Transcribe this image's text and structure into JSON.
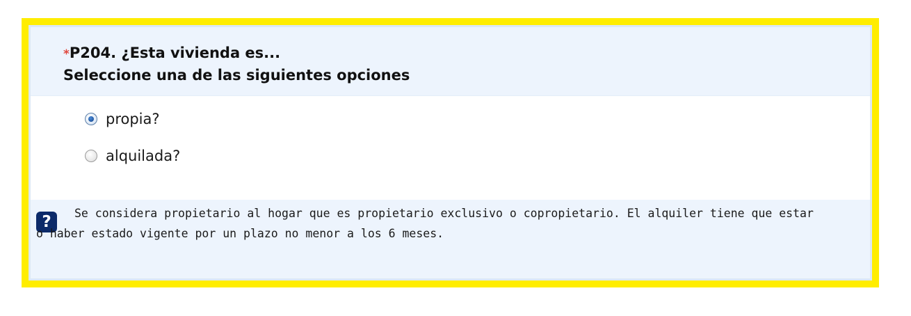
{
  "question": {
    "required_marker": "*",
    "title": "P204. ¿Esta vivienda es...",
    "instruction": "Seleccione una de las siguientes opciones"
  },
  "options": [
    {
      "label": "propia?",
      "selected": true
    },
    {
      "label": "alquilada?",
      "selected": false
    }
  ],
  "help": {
    "icon": "question-help-icon",
    "icon_glyph": "?",
    "text": "Se considera propietario al hogar que es propietario exclusivo o copropietario. El alquiler tiene que estar o haber estado vigente por un plazo no menor a los 6 meses."
  },
  "colors": {
    "highlight_border": "#ffed00",
    "header_background": "#edf4fd",
    "required_marker": "#e0473d",
    "help_icon_background": "#0c2a69"
  }
}
